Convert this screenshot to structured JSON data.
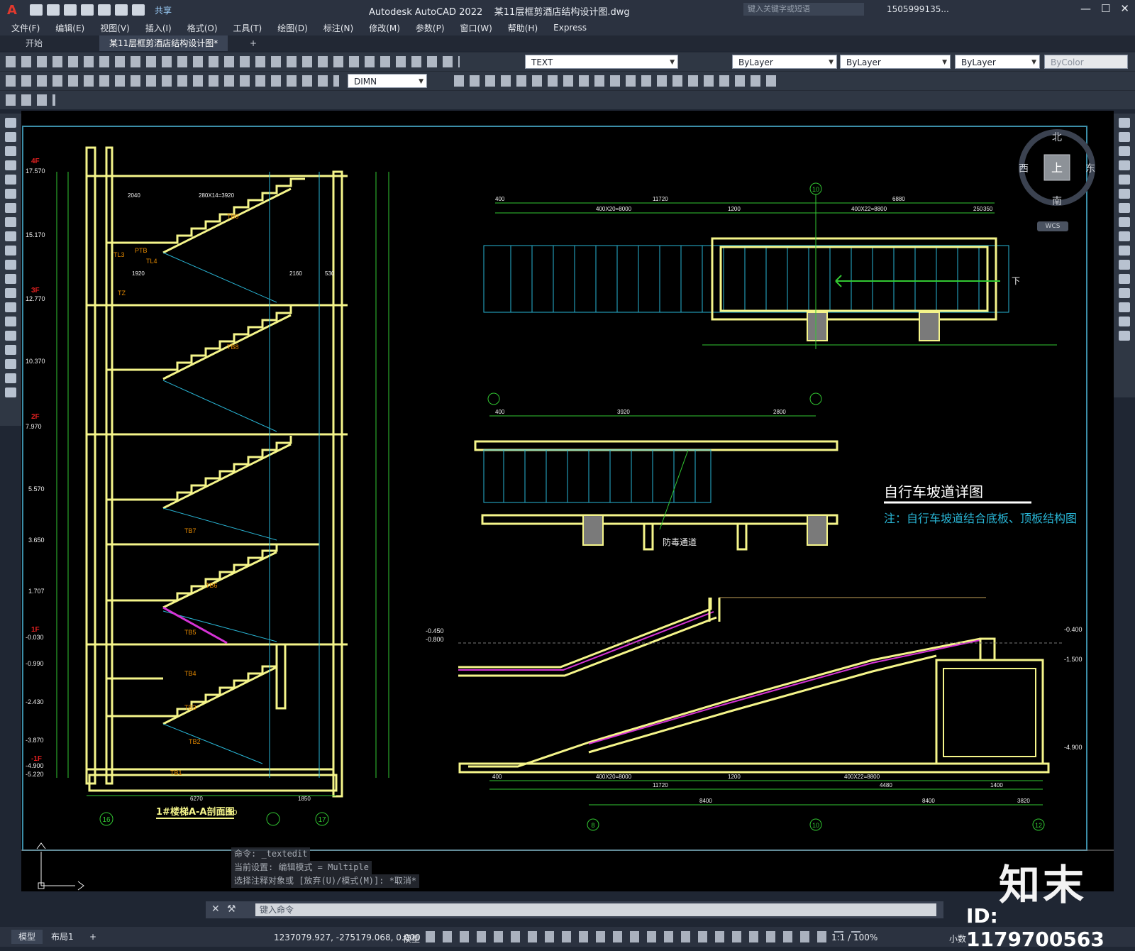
{
  "app": {
    "logo": "A",
    "title": "Autodesk AutoCAD 2022",
    "document": "某11层框剪酒店结构设计图.dwg",
    "share_label": "共享",
    "search_placeholder": "键入关键字或短语",
    "user": "1505999135...",
    "window_controls": [
      "—",
      "☐",
      "✕"
    ]
  },
  "menu": [
    "文件(F)",
    "编辑(E)",
    "视图(V)",
    "插入(I)",
    "格式(O)",
    "工具(T)",
    "绘图(D)",
    "标注(N)",
    "修改(M)",
    "参数(P)",
    "窗口(W)",
    "帮助(H)",
    "Express"
  ],
  "tabs": {
    "start": "开始",
    "active": "某11层框剪酒店结构设计图*",
    "add": "+"
  },
  "toolbars": {
    "text_style": "TEXT",
    "dim_style": "DIMN",
    "layer": "ByLayer",
    "linetype": "ByLayer",
    "lineweight": "ByLayer",
    "color": "ByColor"
  },
  "viewcube": {
    "north": "北",
    "south": "南",
    "west": "西",
    "east": "东",
    "face": "上",
    "wcs": "WCS"
  },
  "drawing": {
    "stair_title": "1#楼梯A-A剖面图",
    "stair_scale": "1:50",
    "ramp_title": "自行车坡道详图",
    "ramp_note": "注：自行车坡道结合底板、顶板结构图",
    "defense_passage": "防毒通道",
    "down_label": "下",
    "floor_tags": [
      "4F",
      "3F",
      "2F",
      "1F",
      "-1F"
    ],
    "elevations_left": [
      "17.570",
      "15.170",
      "12.770",
      "10.370",
      "7.970",
      "5.570",
      "3.650",
      "1.707",
      "-0.030",
      "-0.990",
      "-2.430",
      "-3.870",
      "-4.900",
      "-5.220"
    ],
    "elevations_ramp": [
      "-0.450",
      "-0.800",
      "-0.400",
      "-1.500",
      "-4.900"
    ],
    "axis_labels": [
      "16",
      "17",
      "8",
      "10",
      "12",
      "10"
    ],
    "stair_labels": [
      "TB9",
      "TB8",
      "TB7",
      "TB6",
      "TB5",
      "TB4",
      "TB3",
      "TB2",
      "TB1",
      "PTB",
      "TL3",
      "TL4",
      "TZ"
    ],
    "dims_top": [
      "400",
      "11720",
      "6880",
      "400X20=8000",
      "1200",
      "400X22=8800",
      "250",
      "350"
    ],
    "dims_mid": [
      "400",
      "3920",
      "2800"
    ],
    "dims_bottom": [
      "400",
      "400X20=8000",
      "1200",
      "400X22=8800",
      "11720",
      "4480",
      "1400",
      "8400",
      "8400",
      "3820"
    ],
    "stair_dims": [
      "6270",
      "1850",
      "2040",
      "280X14=3920",
      "1920",
      "2160",
      "530"
    ]
  },
  "command": {
    "history": [
      "命令: _textedit",
      "当前设置: 编辑模式 = Multiple",
      "选择注释对象或 [放弃(U)/模式(M)]: *取消*"
    ],
    "placeholder": "键入命令"
  },
  "status": {
    "layouts": [
      "模型",
      "布局1",
      "+"
    ],
    "coords": "1237079.927, -275179.068, 0.000",
    "space": "模型",
    "scale": "1:1 / 100%",
    "units": "小数"
  },
  "watermark": {
    "logo": "知末",
    "id": "ID: 1179700563"
  },
  "colors": {
    "canvas": "#000000",
    "yellow": "#f5f58a",
    "green": "#32c832",
    "cyan": "#29b6d6",
    "orange": "#e68a00",
    "magenta": "#d633d6",
    "red": "#e02020"
  }
}
